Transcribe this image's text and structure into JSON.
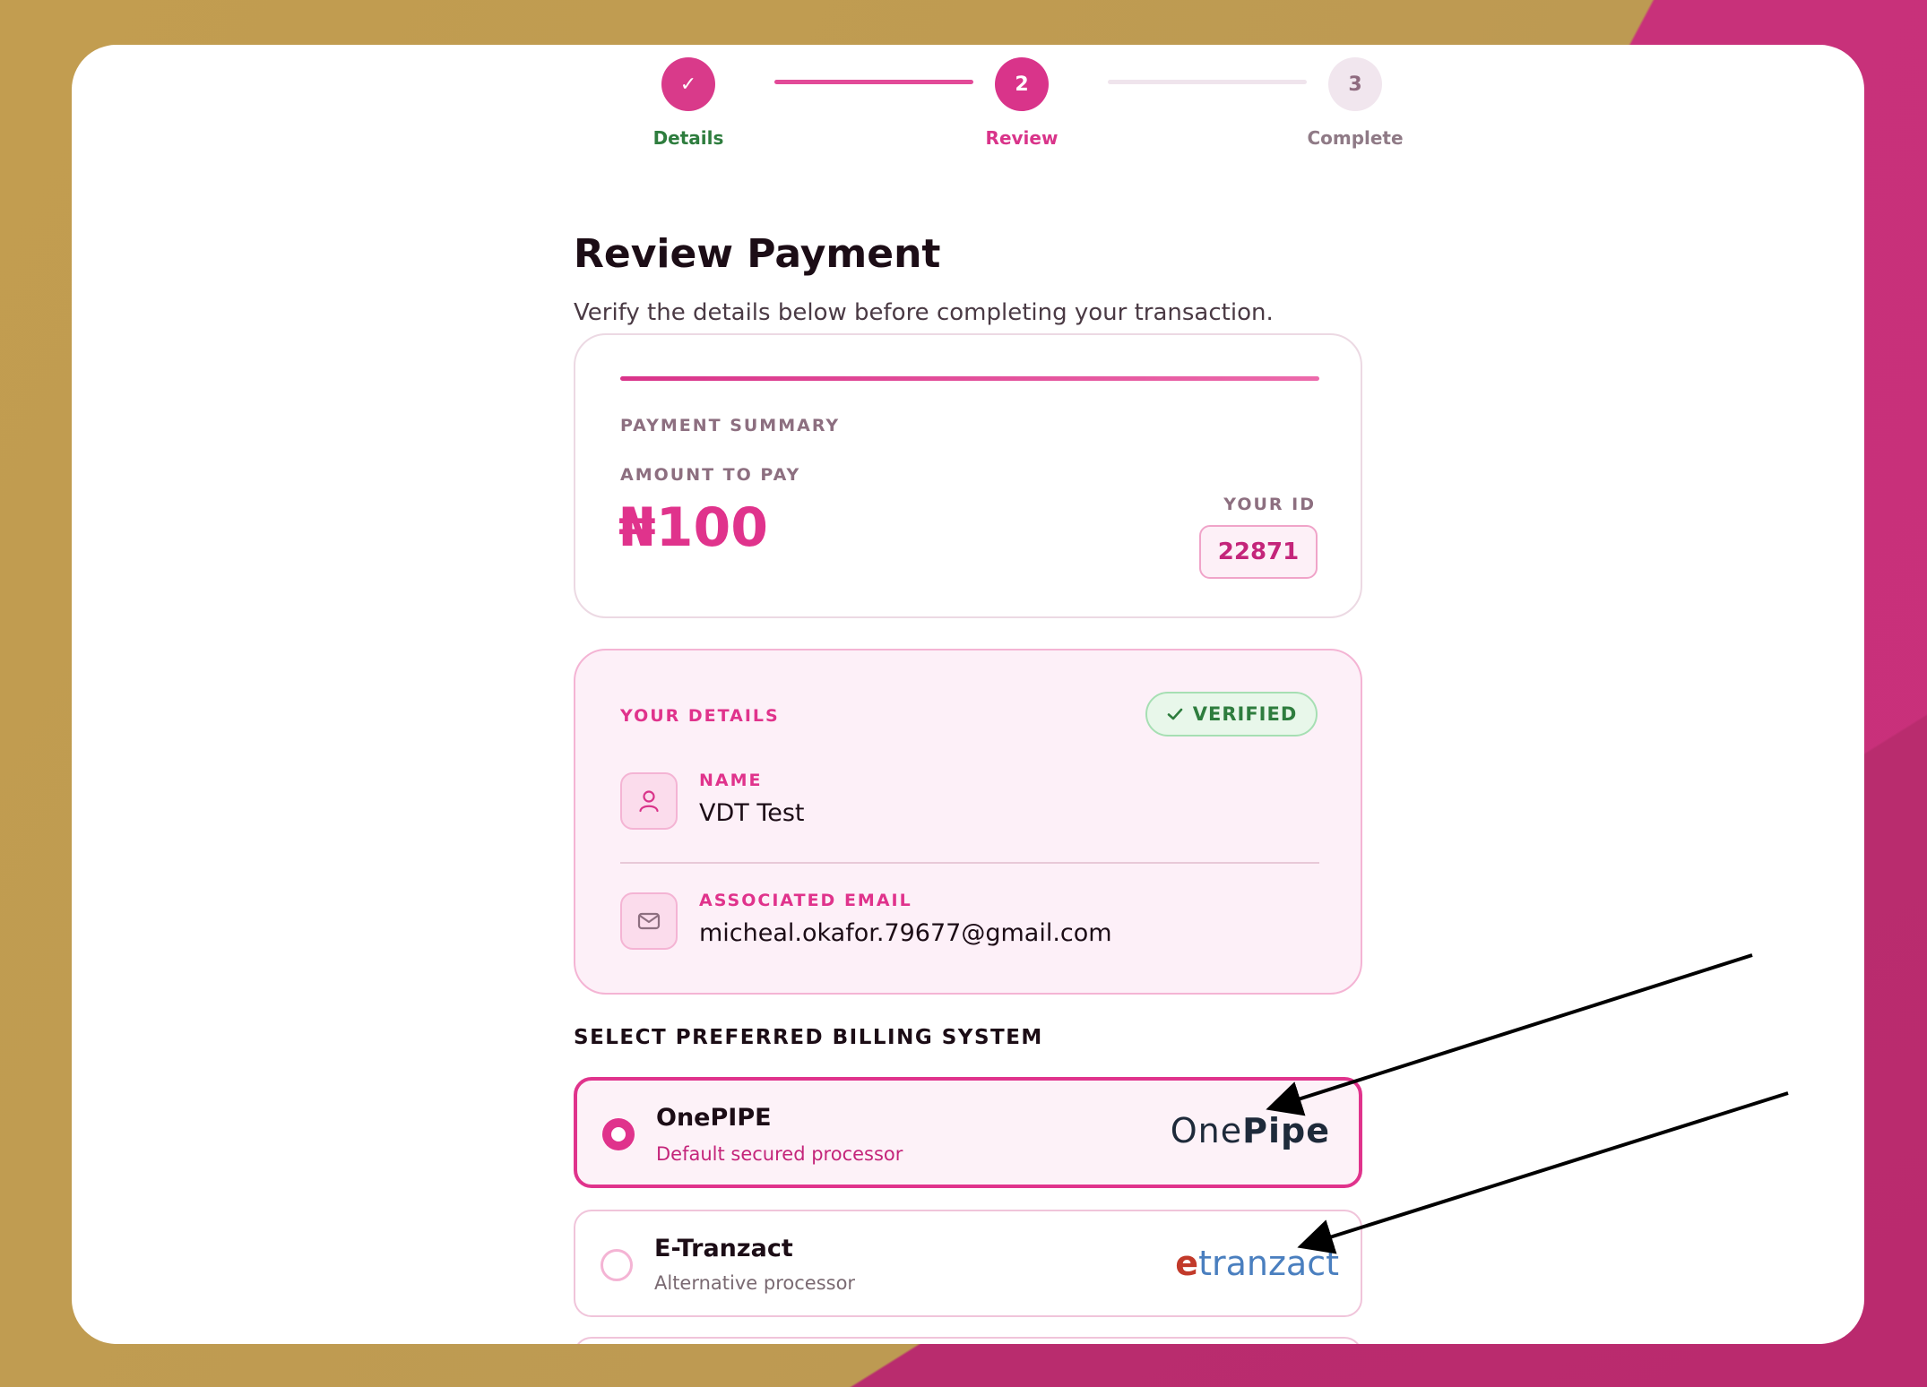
{
  "stepper": {
    "steps": [
      {
        "number": "✓",
        "label": "Details",
        "state": "done"
      },
      {
        "number": "2",
        "label": "Review",
        "state": "current"
      },
      {
        "number": "3",
        "label": "Complete",
        "state": "pending"
      }
    ]
  },
  "page": {
    "title": "Review Payment",
    "subtitle": "Verify the details below before completing your transaction."
  },
  "summary": {
    "heading": "PAYMENT SUMMARY",
    "amount_label": "AMOUNT TO PAY",
    "amount": "₦100",
    "id_label": "YOUR ID",
    "id_value": "22871"
  },
  "details": {
    "heading": "YOUR DETAILS",
    "verified_label": "VERIFIED",
    "name_label": "NAME",
    "name_value": "VDT Test",
    "email_label": "ASSOCIATED EMAIL",
    "email_value": "micheal.okafor.79677@gmail.com"
  },
  "billing": {
    "heading": "SELECT PREFERRED BILLING SYSTEM",
    "options": [
      {
        "name": "OnePIPE",
        "subtitle": "Default secured processor",
        "logo_a": "One",
        "logo_b": "Pipe",
        "selected": true
      },
      {
        "name": "E-Tranzact",
        "subtitle": "Alternative processor",
        "logo_a": "e",
        "logo_b": "tranzact",
        "selected": false
      }
    ]
  },
  "colors": {
    "accent": "#e0338c",
    "success": "#2e7d3e",
    "background_gold": "#c29d50",
    "background_magenta": "#c9307b"
  }
}
